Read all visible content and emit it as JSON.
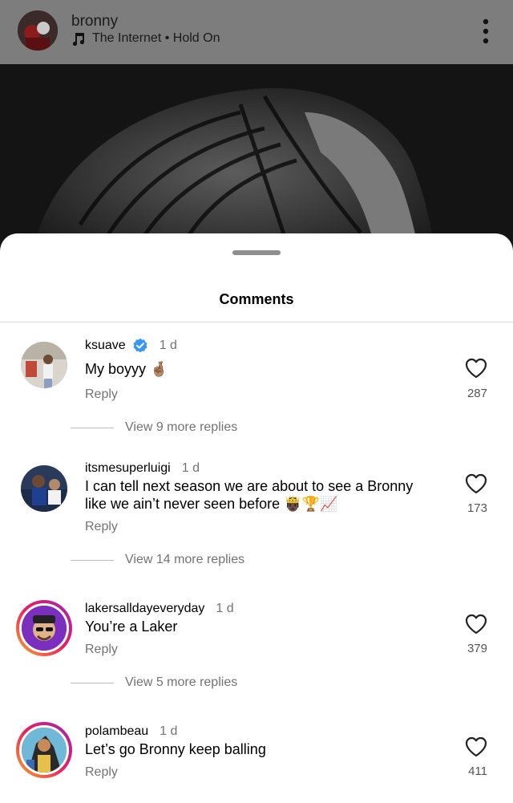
{
  "post": {
    "username": "bronny",
    "audio": "The Internet • Hold On",
    "audio_icon": "music-note-icon",
    "more_icon": "more-vertical-icon"
  },
  "sheet": {
    "title": "Comments"
  },
  "comments": [
    {
      "username": "ksuave",
      "verified": true,
      "time": "1 d",
      "text": "My boyyy 🤞🏽",
      "reply": "Reply",
      "likes": "287",
      "view_replies": "View 9 more replies"
    },
    {
      "username": "itsmesuperluigi",
      "verified": false,
      "time": "1 d",
      "text": "I can tell next season we are about to see a Bronny like we ain’t never seen before 🤴🏿🏆📈",
      "reply": "Reply",
      "likes": "173",
      "view_replies": "View 14 more replies"
    },
    {
      "username": "lakersalldayeveryday",
      "verified": false,
      "time": "1 d",
      "text": "You’re a Laker",
      "reply": "Reply",
      "likes": "379",
      "view_replies": "View 5 more replies"
    },
    {
      "username": "polambeau",
      "verified": false,
      "time": "1 d",
      "text": "Let’s go Bronny keep balling",
      "reply": "Reply",
      "likes": "411"
    }
  ]
}
